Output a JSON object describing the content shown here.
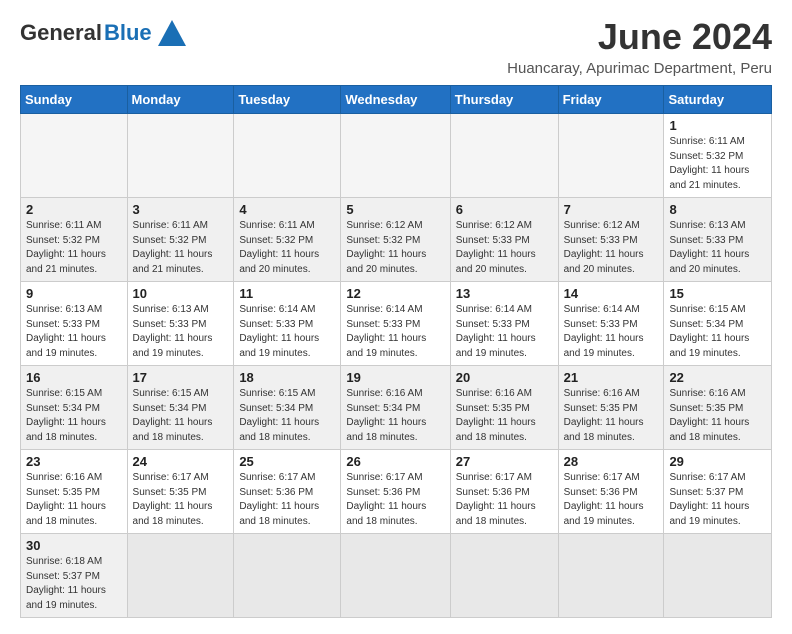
{
  "header": {
    "logo_text_general": "General",
    "logo_text_blue": "Blue",
    "month_title": "June 2024",
    "subtitle": "Huancaray, Apurimac Department, Peru"
  },
  "weekdays": [
    "Sunday",
    "Monday",
    "Tuesday",
    "Wednesday",
    "Thursday",
    "Friday",
    "Saturday"
  ],
  "weeks": [
    [
      {
        "day": "",
        "info": ""
      },
      {
        "day": "",
        "info": ""
      },
      {
        "day": "",
        "info": ""
      },
      {
        "day": "",
        "info": ""
      },
      {
        "day": "",
        "info": ""
      },
      {
        "day": "",
        "info": ""
      },
      {
        "day": "1",
        "info": "Sunrise: 6:11 AM\nSunset: 5:32 PM\nDaylight: 11 hours\nand 21 minutes."
      }
    ],
    [
      {
        "day": "2",
        "info": "Sunrise: 6:11 AM\nSunset: 5:32 PM\nDaylight: 11 hours\nand 21 minutes."
      },
      {
        "day": "3",
        "info": "Sunrise: 6:11 AM\nSunset: 5:32 PM\nDaylight: 11 hours\nand 21 minutes."
      },
      {
        "day": "4",
        "info": "Sunrise: 6:11 AM\nSunset: 5:32 PM\nDaylight: 11 hours\nand 20 minutes."
      },
      {
        "day": "5",
        "info": "Sunrise: 6:12 AM\nSunset: 5:32 PM\nDaylight: 11 hours\nand 20 minutes."
      },
      {
        "day": "6",
        "info": "Sunrise: 6:12 AM\nSunset: 5:33 PM\nDaylight: 11 hours\nand 20 minutes."
      },
      {
        "day": "7",
        "info": "Sunrise: 6:12 AM\nSunset: 5:33 PM\nDaylight: 11 hours\nand 20 minutes."
      },
      {
        "day": "8",
        "info": "Sunrise: 6:13 AM\nSunset: 5:33 PM\nDaylight: 11 hours\nand 20 minutes."
      }
    ],
    [
      {
        "day": "9",
        "info": "Sunrise: 6:13 AM\nSunset: 5:33 PM\nDaylight: 11 hours\nand 19 minutes."
      },
      {
        "day": "10",
        "info": "Sunrise: 6:13 AM\nSunset: 5:33 PM\nDaylight: 11 hours\nand 19 minutes."
      },
      {
        "day": "11",
        "info": "Sunrise: 6:14 AM\nSunset: 5:33 PM\nDaylight: 11 hours\nand 19 minutes."
      },
      {
        "day": "12",
        "info": "Sunrise: 6:14 AM\nSunset: 5:33 PM\nDaylight: 11 hours\nand 19 minutes."
      },
      {
        "day": "13",
        "info": "Sunrise: 6:14 AM\nSunset: 5:33 PM\nDaylight: 11 hours\nand 19 minutes."
      },
      {
        "day": "14",
        "info": "Sunrise: 6:14 AM\nSunset: 5:33 PM\nDaylight: 11 hours\nand 19 minutes."
      },
      {
        "day": "15",
        "info": "Sunrise: 6:15 AM\nSunset: 5:34 PM\nDaylight: 11 hours\nand 19 minutes."
      }
    ],
    [
      {
        "day": "16",
        "info": "Sunrise: 6:15 AM\nSunset: 5:34 PM\nDaylight: 11 hours\nand 18 minutes."
      },
      {
        "day": "17",
        "info": "Sunrise: 6:15 AM\nSunset: 5:34 PM\nDaylight: 11 hours\nand 18 minutes."
      },
      {
        "day": "18",
        "info": "Sunrise: 6:15 AM\nSunset: 5:34 PM\nDaylight: 11 hours\nand 18 minutes."
      },
      {
        "day": "19",
        "info": "Sunrise: 6:16 AM\nSunset: 5:34 PM\nDaylight: 11 hours\nand 18 minutes."
      },
      {
        "day": "20",
        "info": "Sunrise: 6:16 AM\nSunset: 5:35 PM\nDaylight: 11 hours\nand 18 minutes."
      },
      {
        "day": "21",
        "info": "Sunrise: 6:16 AM\nSunset: 5:35 PM\nDaylight: 11 hours\nand 18 minutes."
      },
      {
        "day": "22",
        "info": "Sunrise: 6:16 AM\nSunset: 5:35 PM\nDaylight: 11 hours\nand 18 minutes."
      }
    ],
    [
      {
        "day": "23",
        "info": "Sunrise: 6:16 AM\nSunset: 5:35 PM\nDaylight: 11 hours\nand 18 minutes."
      },
      {
        "day": "24",
        "info": "Sunrise: 6:17 AM\nSunset: 5:35 PM\nDaylight: 11 hours\nand 18 minutes."
      },
      {
        "day": "25",
        "info": "Sunrise: 6:17 AM\nSunset: 5:36 PM\nDaylight: 11 hours\nand 18 minutes."
      },
      {
        "day": "26",
        "info": "Sunrise: 6:17 AM\nSunset: 5:36 PM\nDaylight: 11 hours\nand 18 minutes."
      },
      {
        "day": "27",
        "info": "Sunrise: 6:17 AM\nSunset: 5:36 PM\nDaylight: 11 hours\nand 18 minutes."
      },
      {
        "day": "28",
        "info": "Sunrise: 6:17 AM\nSunset: 5:36 PM\nDaylight: 11 hours\nand 19 minutes."
      },
      {
        "day": "29",
        "info": "Sunrise: 6:17 AM\nSunset: 5:37 PM\nDaylight: 11 hours\nand 19 minutes."
      }
    ],
    [
      {
        "day": "30",
        "info": "Sunrise: 6:18 AM\nSunset: 5:37 PM\nDaylight: 11 hours\nand 19 minutes."
      },
      {
        "day": "",
        "info": ""
      },
      {
        "day": "",
        "info": ""
      },
      {
        "day": "",
        "info": ""
      },
      {
        "day": "",
        "info": ""
      },
      {
        "day": "",
        "info": ""
      },
      {
        "day": "",
        "info": ""
      }
    ]
  ]
}
